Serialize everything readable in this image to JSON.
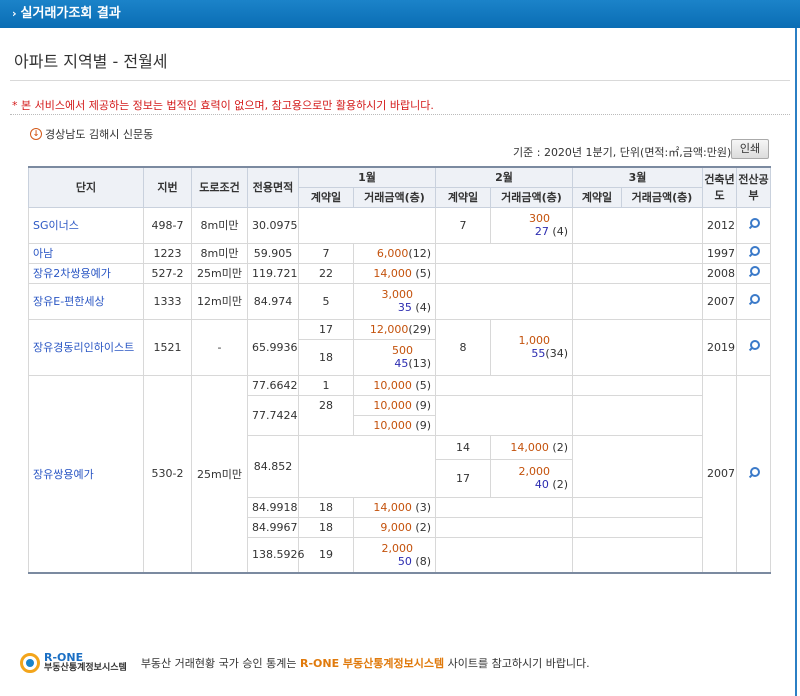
{
  "header": {
    "title": "실거래가조회 결과"
  },
  "page_title": "아파트 지역별 - 전월세",
  "notice": "* 본 서비스에서 제공하는 정보는 법적인 효력이 없으며, 참고용으로만 활용하시기 바랍니다.",
  "location": "경상남도 김해시 신문동",
  "basis": "기준 : 2020년 1분기, 단위(면적:㎡,금액:만원)",
  "print_label": "인쇄",
  "columns": {
    "complex": "단지",
    "lot": "지번",
    "road": "도로조건",
    "area": "전용면적",
    "m1": "1월",
    "m2": "2월",
    "m3": "3월",
    "contract_day": "계약일",
    "amount": "거래금액(층)",
    "year": "건축년도",
    "pub": "전산공부"
  },
  "rows": {
    "r1": {
      "name": "SG이너스",
      "lot": "498-7",
      "road": "8m미만",
      "area": "30.0975",
      "m2_day": "7",
      "m2_amt1": "300",
      "m2_amt2": "27",
      "m2_floor": "(4)",
      "year": "2012"
    },
    "r2": {
      "name": "아남",
      "lot": "1223",
      "road": "8m미만",
      "area": "59.905",
      "m1_day": "7",
      "m1_amt": "6,000",
      "m1_floor": "(12)",
      "year": "1997"
    },
    "r3": {
      "name": "장유2차쌍용예가",
      "lot": "527-2",
      "road": "25m미만",
      "area": "119.721",
      "m1_day": "22",
      "m1_amt": "14,000",
      "m1_floor": "(5)",
      "year": "2008"
    },
    "r4": {
      "name": "장유E-편한세상",
      "lot": "1333",
      "road": "12m미만",
      "area": "84.974",
      "m1_day": "5",
      "m1_amt1": "3,000",
      "m1_amt2": "35",
      "m1_floor": "(4)",
      "year": "2007"
    },
    "r5": {
      "name": "장유경동리인하이스트",
      "lot": "1521",
      "road": "-",
      "area": "65.9936",
      "m1a_day": "17",
      "m1a_amt": "12,000",
      "m1a_floor": "(29)",
      "m1b_day": "18",
      "m1b_amt1": "500",
      "m1b_amt2": "45",
      "m1b_floor": "(13)",
      "m2_day": "8",
      "m2_amt1": "1,000",
      "m2_amt2": "55",
      "m2_floor": "(34)",
      "year": "2019"
    },
    "r6": {
      "name": "장유쌍용예가",
      "lot": "530-2",
      "road": "25m미만",
      "year": "2007",
      "s1": {
        "area": "77.6642",
        "day": "1",
        "amt": "10,000",
        "floor": "(5)"
      },
      "s2": {
        "area": "77.7424",
        "day": "28",
        "amt": "10,000",
        "floor": "(9)",
        "amt_b": "10,000",
        "floor_b": "(9)"
      },
      "s3": {
        "area": "84.852",
        "d1": "14",
        "amt1": "14,000",
        "floor1": "(2)",
        "d2": "17",
        "amt2a": "2,000",
        "amt2b": "40",
        "floor2": "(2)"
      },
      "s4": {
        "area": "84.9918",
        "day": "18",
        "amt": "14,000",
        "floor": "(3)"
      },
      "s5": {
        "area": "84.9967",
        "day": "18",
        "amt": "9,000",
        "floor": "(2)"
      },
      "s6": {
        "area": "138.5926",
        "day": "19",
        "amt1": "2,000",
        "amt2": "50",
        "floor": "(8)"
      }
    }
  },
  "footer": {
    "brand": "R-ONE",
    "brand_sub": "부동산통계정보시스템",
    "text_pre": "부동산 거래현황 국가 승인 통계는 ",
    "text_hl": "R-ONE 부동산통계정보시스템",
    "text_post": " 사이트를 참고하시기 바랍니다."
  },
  "colors": {
    "accent": "#0a6db4",
    "amount": "#c4520c",
    "deposit": "#2b2bb0",
    "notice": "#d31919"
  },
  "icons": {
    "search": "magnifier-icon",
    "info": "info-icon",
    "logo": "r-one-logo"
  }
}
